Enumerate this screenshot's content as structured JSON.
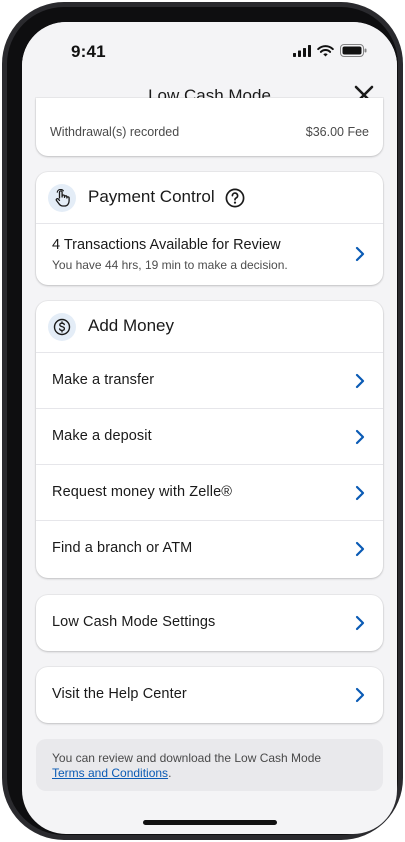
{
  "status": {
    "time": "9:41"
  },
  "nav": {
    "title": "Low Cash Mode"
  },
  "partial": {
    "label": "Withdrawal(s) recorded",
    "value": "$36.00 Fee"
  },
  "payment_control": {
    "title": "Payment Control",
    "review_title": "4 Transactions Available for Review",
    "review_subtitle": "You have 44 hrs, 19 min to make a decision."
  },
  "add_money": {
    "title": "Add Money",
    "items": [
      {
        "label": "Make a transfer"
      },
      {
        "label": "Make a deposit"
      },
      {
        "label": "Request money with Zelle®"
      },
      {
        "label": "Find a branch or ATM"
      }
    ]
  },
  "settings": {
    "label": "Low Cash Mode Settings"
  },
  "help": {
    "label": "Visit the Help Center"
  },
  "info": {
    "text": "You can review and download the Low Cash Mode",
    "link": "Terms and Conditions",
    "suffix": "."
  },
  "colors": {
    "accent": "#0a5bb5",
    "icon_bg": "#e4edf7",
    "background": "#f4f4f6"
  }
}
